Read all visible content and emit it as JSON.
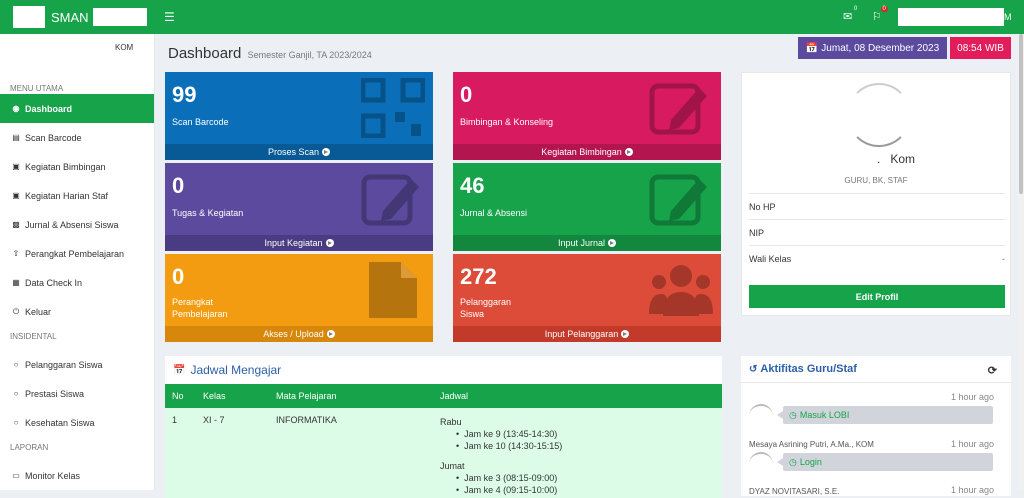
{
  "topbar": {
    "brand": "SMAN",
    "user_suffix": "M",
    "mail_count": "0",
    "flag_count": "0"
  },
  "sidebar": {
    "user_suffix": "KOM",
    "sections": [
      {
        "heading": "MENU UTAMA",
        "items": [
          {
            "label": "Dashboard",
            "icon": "dashboard-icon",
            "active": true
          },
          {
            "label": "Scan Barcode",
            "icon": "barcode-icon"
          },
          {
            "label": "Kegiatan Bimbingan",
            "icon": "briefcase-icon"
          },
          {
            "label": "Kegiatan Harian Staf",
            "icon": "briefcase-icon"
          },
          {
            "label": "Jurnal & Absensi Siswa",
            "icon": "book-icon"
          },
          {
            "label": "Perangkat Pembelajaran",
            "icon": "upload-icon"
          },
          {
            "label": "Data Check In",
            "icon": "calendar-icon"
          },
          {
            "label": "Keluar",
            "icon": "power-icon"
          }
        ]
      },
      {
        "heading": "INSIDENTAL",
        "items": [
          {
            "label": "Pelanggaran Siswa",
            "icon": "circle-icon"
          },
          {
            "label": "Prestasi Siswa",
            "icon": "circle-icon"
          },
          {
            "label": "Kesehatan Siswa",
            "icon": "circle-icon"
          }
        ]
      },
      {
        "heading": "LAPORAN",
        "items": [
          {
            "label": "Monitor Kelas",
            "icon": "monitor-icon"
          }
        ]
      }
    ]
  },
  "header": {
    "title": "Dashboard",
    "subtitle": "Semester Ganjil, TA 2023/2024",
    "date": "Jumat, 08 Desember 2023",
    "time": "08:54 WIB"
  },
  "boxes": [
    {
      "value": "99",
      "label": "Scan Barcode",
      "footer": "Proses Scan",
      "color": "#0a6fb8",
      "footer_color": "#085a96"
    },
    {
      "value": "0",
      "label": "Bimbingan & Konseling",
      "footer": "Kegiatan Bimbingan",
      "color": "#d81b60",
      "footer_color": "#b3154f"
    },
    {
      "value": "0",
      "label": "Tugas & Kegiatan",
      "footer": "Input Kegiatan",
      "color": "#5b4a9e",
      "footer_color": "#4a3c83"
    },
    {
      "value": "46",
      "label": "Jurnal & Absensi",
      "footer": "Input Jurnal",
      "color": "#16a34a",
      "footer_color": "#12873d"
    },
    {
      "value": "0",
      "label": "Perangkat Pembelajaran",
      "footer": "Akses / Upload",
      "color": "#f39c12",
      "footer_color": "#d6870c"
    },
    {
      "value": "272",
      "label": "Pelanggaran Siswa",
      "footer": "Input Pelanggaran",
      "color": "#dd4b39",
      "footer_color": "#c23a2a"
    }
  ],
  "profile": {
    "name": "Kom",
    "role": "GURU, BK, STAF",
    "rows": [
      {
        "label": "No HP",
        "value": ""
      },
      {
        "label": "NIP",
        "value": ""
      },
      {
        "label": "Wali Kelas",
        "value": "-"
      }
    ],
    "edit_label": "Edit Profil"
  },
  "schedule": {
    "title": "Jadwal Mengajar",
    "columns": [
      "No",
      "Kelas",
      "Mata Pelajaran",
      "Jadwal"
    ],
    "rows": [
      {
        "no": "1",
        "kelas": "XI - 7",
        "mapel": "INFORMATIKA",
        "jadwal": [
          {
            "day": "Rabu",
            "slots": [
              "Jam ke 9 (13:45-14:30)",
              "Jam ke 10 (14:30-15:15)"
            ]
          },
          {
            "day": "Jumat",
            "slots": [
              "Jam ke 3 (08:15-09:00)",
              "Jam ke 4 (09:15-10:00)"
            ]
          }
        ]
      }
    ]
  },
  "activity": {
    "title": "Aktifitas Guru/Staf",
    "items": [
      {
        "name": "",
        "time": "1 hour ago",
        "message": "Masuk LOBI"
      },
      {
        "name": "Mesaya Asrining Putri, A.Ma., KOM",
        "time": "1 hour ago",
        "message": "Login"
      },
      {
        "name": "DYAZ NOVITASARI, S.E.",
        "time": "1 hour ago",
        "message": ""
      }
    ]
  }
}
